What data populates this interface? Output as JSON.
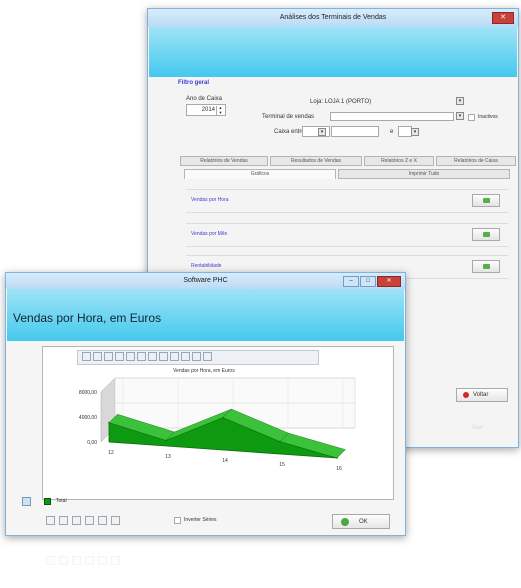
{
  "back_window": {
    "title": "Análises dos Terminais de Vendas",
    "section_title": "Filtro geral",
    "ano_label": "Ano de Caixa",
    "ano_value": "2014",
    "loja_value": "Loja: LOJA 1 (PORTO)",
    "terminal_label": "Terminal de vendas",
    "inactive_label": "Inactivos",
    "caixa_label": "Caixa entre",
    "caixa_sep": "e",
    "tabs": [
      "Relatórios de Vendas",
      "Resultados de Vendas",
      "Relatórios Z e X",
      "Relatórios de Caixa"
    ],
    "subtabs": [
      "Gráficos",
      "Imprimir Tudo"
    ],
    "rows": [
      "Vendas por Hora",
      "Vendas por Mês",
      "Rentabilidade"
    ],
    "voltar_label": "Voltar",
    "sair_label": "Sair",
    "colors": {
      "banner": "#44c9ee",
      "link": "#3d3ad0",
      "go": "#56b04a"
    }
  },
  "front_window": {
    "title": "Software PHC",
    "heading": "Vendas por Hora, em Euros",
    "legend_label": "Total",
    "invert_label": "Inverter Séries",
    "ok_label": "OK",
    "toolbar_icons": [
      "save-icon",
      "copy-icon",
      "chart-type-icon",
      "palette-icon",
      "view-icon-1",
      "view-icon-2",
      "view-icon-3",
      "view-icon-4",
      "view-icon-5",
      "zoom-icon",
      "print-icon",
      "export-icon"
    ],
    "bottom_icons": [
      "tool-icon-1",
      "tool-icon-2",
      "tool-icon-3",
      "tool-icon-4",
      "tool-icon-5",
      "tool-icon-6"
    ]
  },
  "chart_data": {
    "type": "area",
    "title": "Vendas por Hora, em Euros",
    "categories": [
      "12",
      "13",
      "14",
      "15",
      "16"
    ],
    "series": [
      {
        "name": "Total",
        "values": [
          3100,
          900,
          5200,
          2000,
          0
        ]
      }
    ],
    "yticks": [
      "8000,00",
      "4000,00",
      "0,00"
    ],
    "ylim": [
      0,
      8000
    ],
    "legend_position": "bottom-left",
    "grid": true,
    "three_d": true,
    "color": "#0e9a10"
  }
}
